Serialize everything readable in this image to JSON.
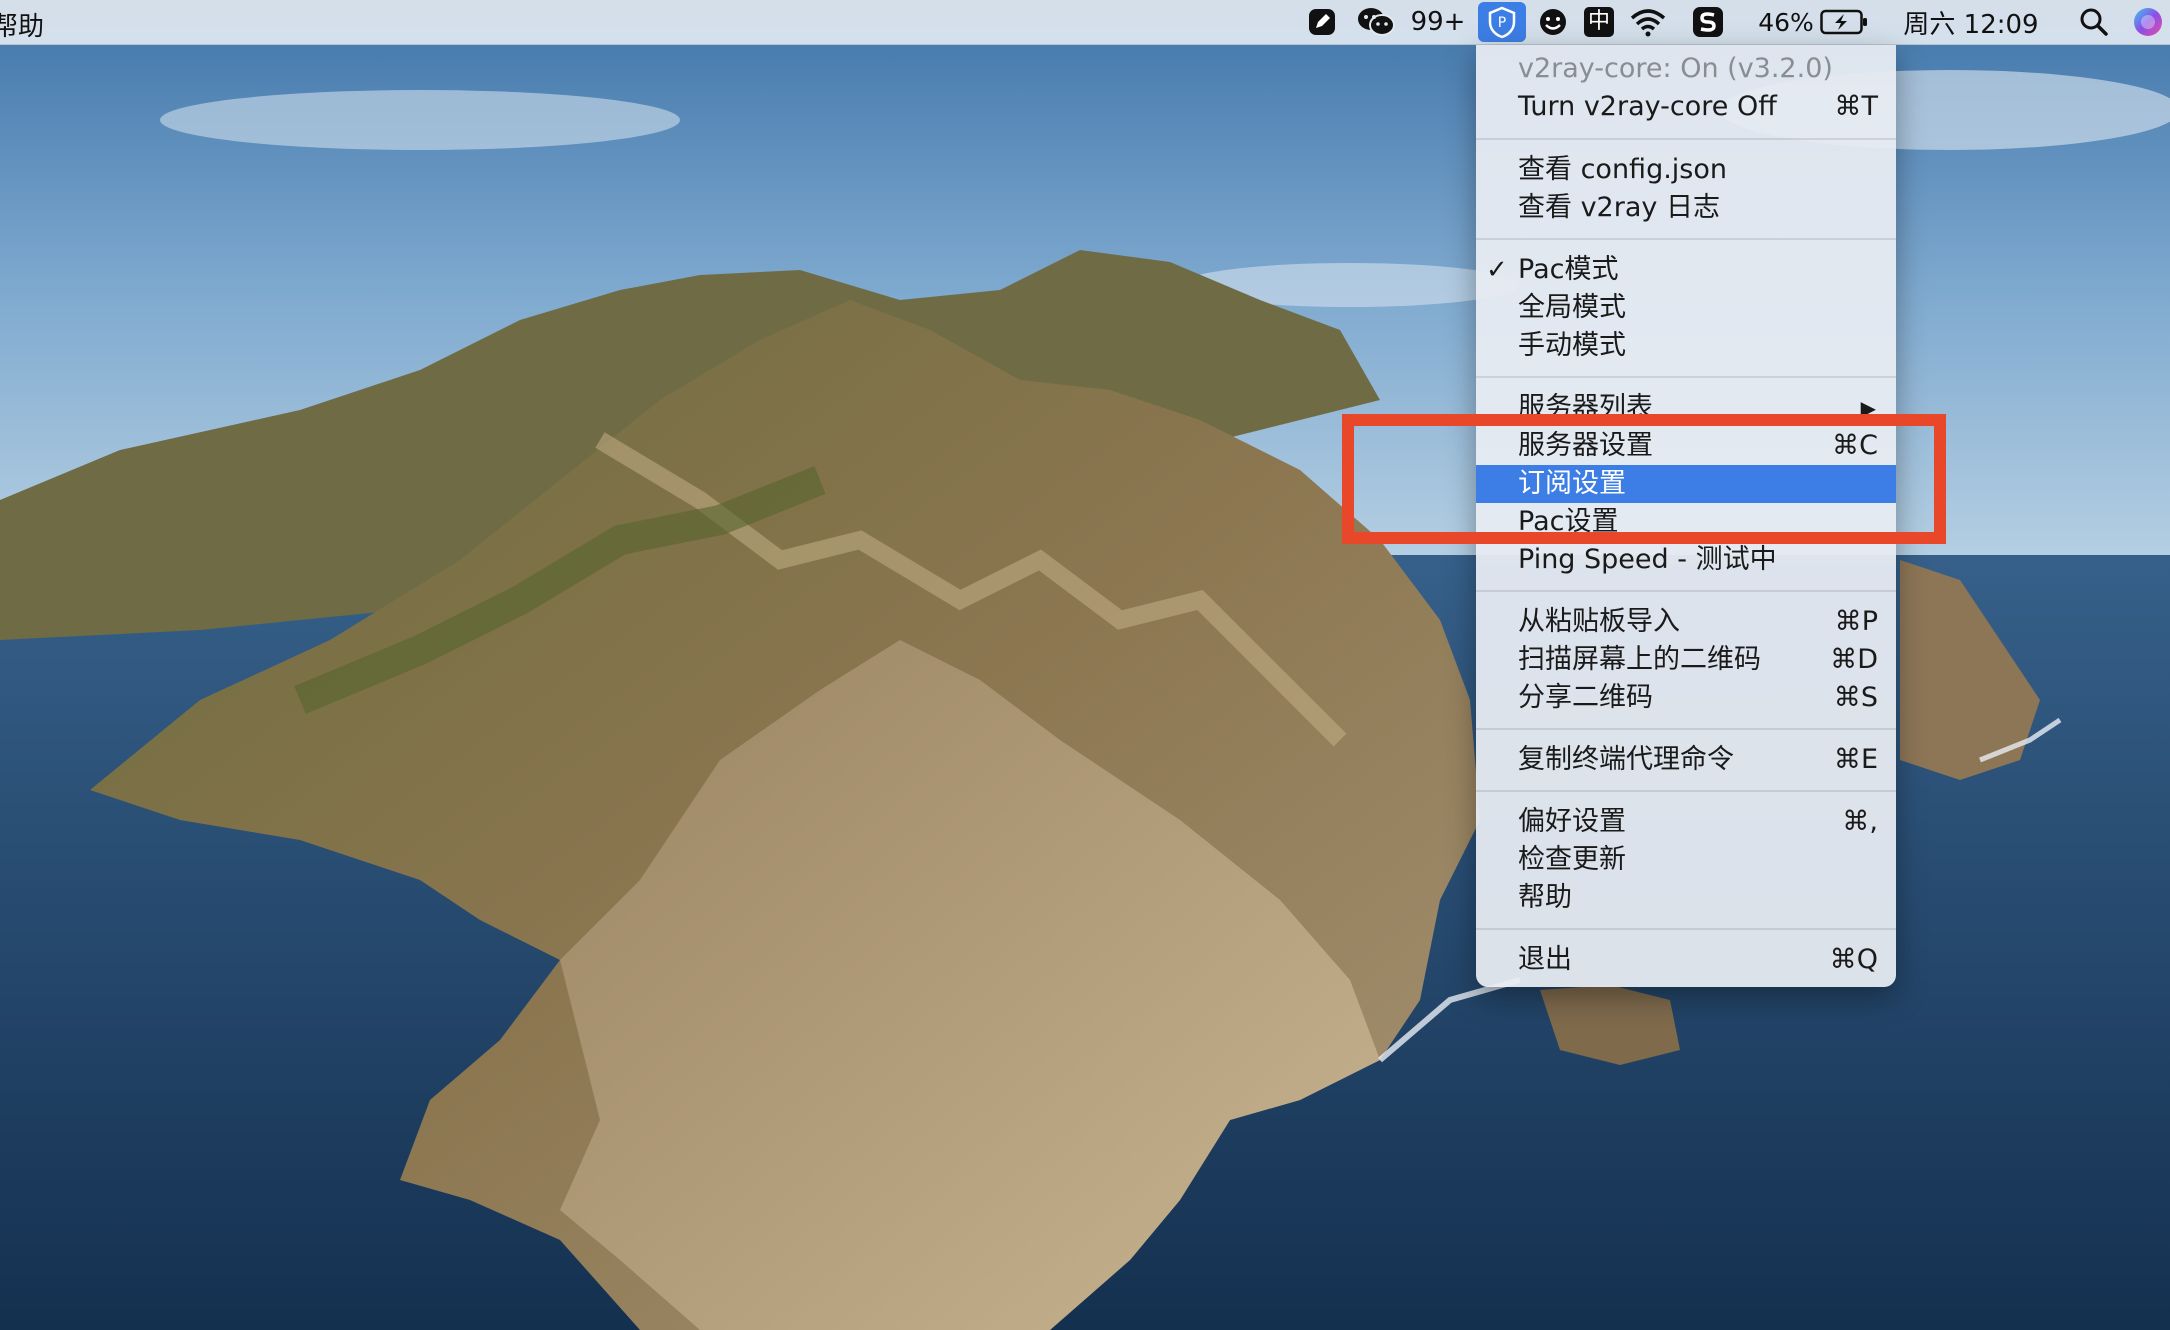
{
  "menubar": {
    "app_menu_fragment": "帮助",
    "wechat_badge": "99+",
    "battery_percent": "46%",
    "clock": "周六 12:09",
    "input_method": "中",
    "status_icons": [
      "note-icon",
      "wechat-icon",
      "v2ray-tray-icon",
      "face-icon",
      "input-method-icon",
      "wifi-icon",
      "s-app-icon",
      "battery-icon",
      "search-icon",
      "siri-icon"
    ]
  },
  "menu": {
    "status": "v2ray-core: On  (v3.2.0)",
    "toggle": {
      "label": "Turn v2ray-core Off",
      "shortcut": "⌘T"
    },
    "view_config": "查看 config.json",
    "view_log": "查看 v2ray 日志",
    "pac_mode": {
      "label": "Pac模式",
      "check": "✓"
    },
    "global_mode": "全局模式",
    "manual_mode": "手动模式",
    "server_list": {
      "label": "服务器列表",
      "arrow": "▶"
    },
    "server_settings": {
      "label": "服务器设置",
      "shortcut": "⌘C"
    },
    "subscription_settings": {
      "label": "订阅设置"
    },
    "pac_settings": {
      "label": "Pac设置"
    },
    "ping_speed": "Ping Speed - 测试中",
    "import_clipboard": {
      "label": "从粘贴板导入",
      "shortcut": "⌘P"
    },
    "scan_qr": {
      "label": "扫描屏幕上的二维码",
      "shortcut": "⌘D"
    },
    "share_qr": {
      "label": "分享二维码",
      "shortcut": "⌘S"
    },
    "copy_proxy_cmd": {
      "label": "复制终端代理命令",
      "shortcut": "⌘E"
    },
    "preferences": {
      "label": "偏好设置",
      "shortcut": "⌘,"
    },
    "check_updates": "检查更新",
    "help": "帮助",
    "quit": {
      "label": "退出",
      "shortcut": "⌘Q"
    }
  },
  "colors": {
    "selection": "#3d7ee6",
    "annotation_box": "#e8472a"
  }
}
